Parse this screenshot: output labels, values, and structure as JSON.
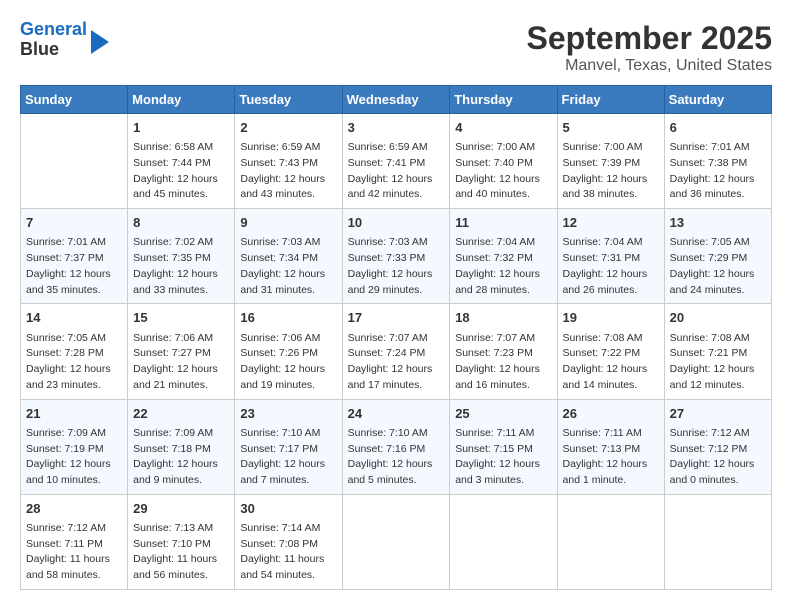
{
  "header": {
    "logo": {
      "line1": "General",
      "line2": "Blue"
    },
    "title": "September 2025",
    "subtitle": "Manvel, Texas, United States"
  },
  "days_of_week": [
    "Sunday",
    "Monday",
    "Tuesday",
    "Wednesday",
    "Thursday",
    "Friday",
    "Saturday"
  ],
  "weeks": [
    [
      {
        "day": "",
        "info": ""
      },
      {
        "day": "1",
        "info": "Sunrise: 6:58 AM\nSunset: 7:44 PM\nDaylight: 12 hours\nand 45 minutes."
      },
      {
        "day": "2",
        "info": "Sunrise: 6:59 AM\nSunset: 7:43 PM\nDaylight: 12 hours\nand 43 minutes."
      },
      {
        "day": "3",
        "info": "Sunrise: 6:59 AM\nSunset: 7:41 PM\nDaylight: 12 hours\nand 42 minutes."
      },
      {
        "day": "4",
        "info": "Sunrise: 7:00 AM\nSunset: 7:40 PM\nDaylight: 12 hours\nand 40 minutes."
      },
      {
        "day": "5",
        "info": "Sunrise: 7:00 AM\nSunset: 7:39 PM\nDaylight: 12 hours\nand 38 minutes."
      },
      {
        "day": "6",
        "info": "Sunrise: 7:01 AM\nSunset: 7:38 PM\nDaylight: 12 hours\nand 36 minutes."
      }
    ],
    [
      {
        "day": "7",
        "info": "Sunrise: 7:01 AM\nSunset: 7:37 PM\nDaylight: 12 hours\nand 35 minutes."
      },
      {
        "day": "8",
        "info": "Sunrise: 7:02 AM\nSunset: 7:35 PM\nDaylight: 12 hours\nand 33 minutes."
      },
      {
        "day": "9",
        "info": "Sunrise: 7:03 AM\nSunset: 7:34 PM\nDaylight: 12 hours\nand 31 minutes."
      },
      {
        "day": "10",
        "info": "Sunrise: 7:03 AM\nSunset: 7:33 PM\nDaylight: 12 hours\nand 29 minutes."
      },
      {
        "day": "11",
        "info": "Sunrise: 7:04 AM\nSunset: 7:32 PM\nDaylight: 12 hours\nand 28 minutes."
      },
      {
        "day": "12",
        "info": "Sunrise: 7:04 AM\nSunset: 7:31 PM\nDaylight: 12 hours\nand 26 minutes."
      },
      {
        "day": "13",
        "info": "Sunrise: 7:05 AM\nSunset: 7:29 PM\nDaylight: 12 hours\nand 24 minutes."
      }
    ],
    [
      {
        "day": "14",
        "info": "Sunrise: 7:05 AM\nSunset: 7:28 PM\nDaylight: 12 hours\nand 23 minutes."
      },
      {
        "day": "15",
        "info": "Sunrise: 7:06 AM\nSunset: 7:27 PM\nDaylight: 12 hours\nand 21 minutes."
      },
      {
        "day": "16",
        "info": "Sunrise: 7:06 AM\nSunset: 7:26 PM\nDaylight: 12 hours\nand 19 minutes."
      },
      {
        "day": "17",
        "info": "Sunrise: 7:07 AM\nSunset: 7:24 PM\nDaylight: 12 hours\nand 17 minutes."
      },
      {
        "day": "18",
        "info": "Sunrise: 7:07 AM\nSunset: 7:23 PM\nDaylight: 12 hours\nand 16 minutes."
      },
      {
        "day": "19",
        "info": "Sunrise: 7:08 AM\nSunset: 7:22 PM\nDaylight: 12 hours\nand 14 minutes."
      },
      {
        "day": "20",
        "info": "Sunrise: 7:08 AM\nSunset: 7:21 PM\nDaylight: 12 hours\nand 12 minutes."
      }
    ],
    [
      {
        "day": "21",
        "info": "Sunrise: 7:09 AM\nSunset: 7:19 PM\nDaylight: 12 hours\nand 10 minutes."
      },
      {
        "day": "22",
        "info": "Sunrise: 7:09 AM\nSunset: 7:18 PM\nDaylight: 12 hours\nand 9 minutes."
      },
      {
        "day": "23",
        "info": "Sunrise: 7:10 AM\nSunset: 7:17 PM\nDaylight: 12 hours\nand 7 minutes."
      },
      {
        "day": "24",
        "info": "Sunrise: 7:10 AM\nSunset: 7:16 PM\nDaylight: 12 hours\nand 5 minutes."
      },
      {
        "day": "25",
        "info": "Sunrise: 7:11 AM\nSunset: 7:15 PM\nDaylight: 12 hours\nand 3 minutes."
      },
      {
        "day": "26",
        "info": "Sunrise: 7:11 AM\nSunset: 7:13 PM\nDaylight: 12 hours\nand 1 minute."
      },
      {
        "day": "27",
        "info": "Sunrise: 7:12 AM\nSunset: 7:12 PM\nDaylight: 12 hours\nand 0 minutes."
      }
    ],
    [
      {
        "day": "28",
        "info": "Sunrise: 7:12 AM\nSunset: 7:11 PM\nDaylight: 11 hours\nand 58 minutes."
      },
      {
        "day": "29",
        "info": "Sunrise: 7:13 AM\nSunset: 7:10 PM\nDaylight: 11 hours\nand 56 minutes."
      },
      {
        "day": "30",
        "info": "Sunrise: 7:14 AM\nSunset: 7:08 PM\nDaylight: 11 hours\nand 54 minutes."
      },
      {
        "day": "",
        "info": ""
      },
      {
        "day": "",
        "info": ""
      },
      {
        "day": "",
        "info": ""
      },
      {
        "day": "",
        "info": ""
      }
    ]
  ]
}
